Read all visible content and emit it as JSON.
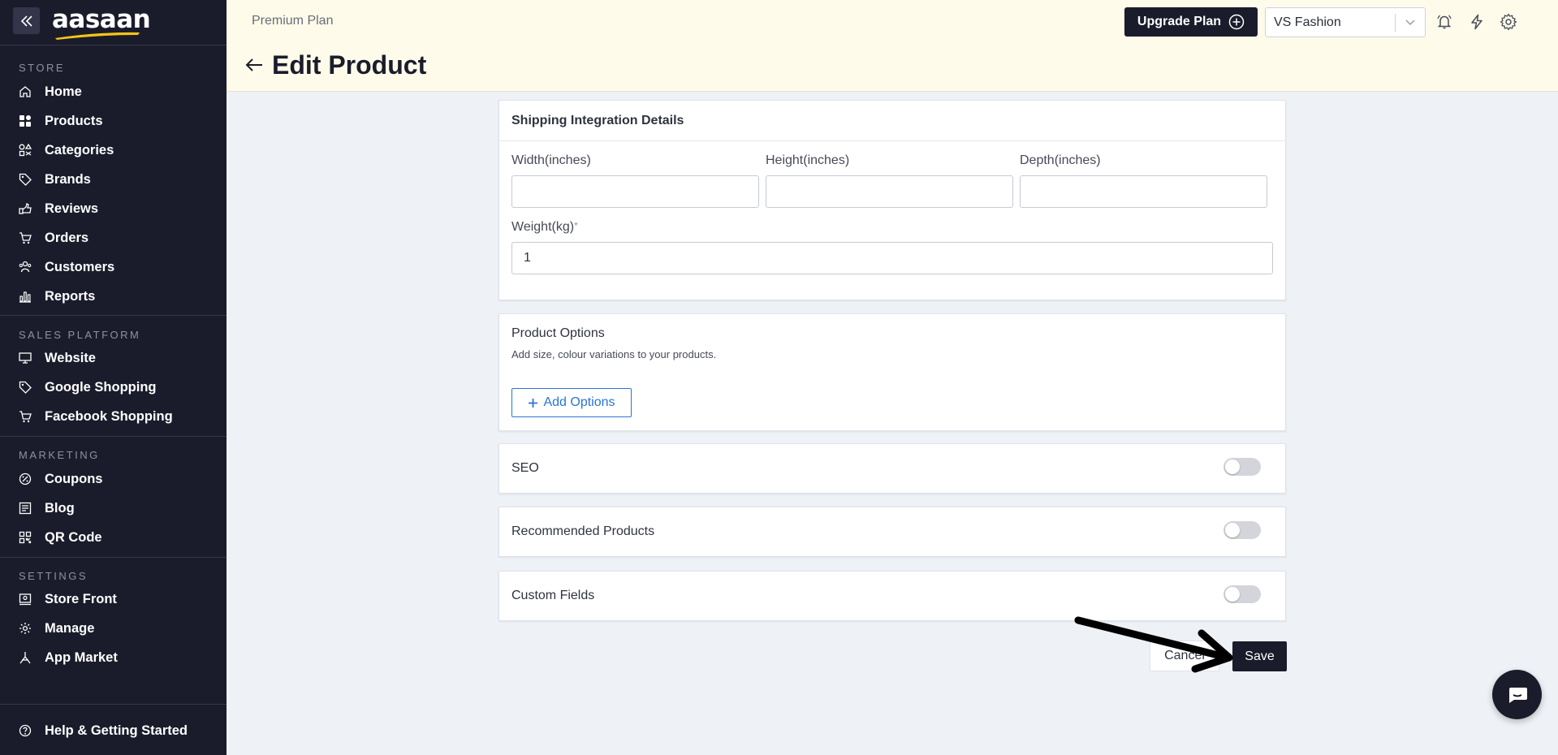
{
  "brand": {
    "logo_text": "aasaan"
  },
  "sidebar": {
    "sections": {
      "store": "STORE",
      "sales": "SALES PLATFORM",
      "marketing": "MARKETING",
      "settings": "SETTINGS"
    },
    "store_items": [
      {
        "label": "Home",
        "icon": "home-icon"
      },
      {
        "label": "Products",
        "icon": "grid-icon"
      },
      {
        "label": "Categories",
        "icon": "shapes-icon"
      },
      {
        "label": "Brands",
        "icon": "tag-icon"
      },
      {
        "label": "Reviews",
        "icon": "reviews-icon"
      },
      {
        "label": "Orders",
        "icon": "cart-icon"
      },
      {
        "label": "Customers",
        "icon": "users-icon"
      },
      {
        "label": "Reports",
        "icon": "bar-chart-icon"
      }
    ],
    "sales_items": [
      {
        "label": "Website",
        "icon": "monitor-icon"
      },
      {
        "label": "Google Shopping",
        "icon": "google-tag-icon"
      },
      {
        "label": "Facebook Shopping",
        "icon": "cart-icon"
      }
    ],
    "marketing_items": [
      {
        "label": "Coupons",
        "icon": "coupon-icon"
      },
      {
        "label": "Blog",
        "icon": "blog-icon"
      },
      {
        "label": "QR Code",
        "icon": "qr-icon"
      }
    ],
    "settings_items": [
      {
        "label": "Store Front",
        "icon": "storefront-icon"
      },
      {
        "label": "Manage",
        "icon": "gear-icon"
      },
      {
        "label": "App Market",
        "icon": "app-market-icon"
      }
    ],
    "help": {
      "label": "Help & Getting Started",
      "icon": "help-icon"
    }
  },
  "header": {
    "plan": "Premium Plan",
    "title": "Edit Product",
    "upgrade_label": "Upgrade Plan",
    "store_name": "VS Fashion"
  },
  "shipping": {
    "title": "Shipping Integration Details",
    "width_label": "Width(inches)",
    "width_value": "",
    "height_label": "Height(inches)",
    "height_value": "",
    "depth_label": "Depth(inches)",
    "depth_value": "",
    "weight_label": "Weight(kg)",
    "weight_required": "*",
    "weight_value": "1"
  },
  "options": {
    "title": "Product Options",
    "subtitle": "Add size, colour variations to your products.",
    "add_label": "Add Options"
  },
  "seo": {
    "title": "SEO",
    "enabled": false
  },
  "recommended": {
    "title": "Recommended Products",
    "enabled": false
  },
  "custom_fields": {
    "title": "Custom Fields",
    "enabled": false
  },
  "actions": {
    "cancel_label": "Cancel",
    "save_label": "Save"
  }
}
